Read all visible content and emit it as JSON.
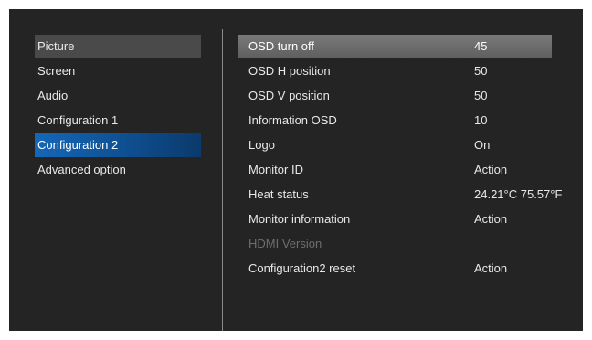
{
  "left_menu": {
    "items": [
      {
        "label": "Picture"
      },
      {
        "label": "Screen"
      },
      {
        "label": "Audio"
      },
      {
        "label": "Configuration 1"
      },
      {
        "label": "Configuration 2"
      },
      {
        "label": "Advanced option"
      }
    ],
    "active": "Configuration 2"
  },
  "settings": {
    "rows": [
      {
        "label": "OSD turn off",
        "value": "45"
      },
      {
        "label": "OSD H position",
        "value": "50"
      },
      {
        "label": "OSD V position",
        "value": "50"
      },
      {
        "label": "Information OSD",
        "value": "10"
      },
      {
        "label": "Logo",
        "value": "On"
      },
      {
        "label": "Monitor ID",
        "value": "Action"
      },
      {
        "label": "Heat status",
        "value": "24.21°C 75.57°F"
      },
      {
        "label": "Monitor information",
        "value": "Action"
      },
      {
        "label": "HDMI Version",
        "value": ""
      },
      {
        "label": "Configuration2 reset",
        "value": "Action"
      }
    ]
  },
  "colors": {
    "background": "#242424",
    "active_tab": "#1567b8",
    "highlight_row": "#6e6e6e",
    "text": "#e8e8e8",
    "disabled_text": "#6e6e6e"
  }
}
